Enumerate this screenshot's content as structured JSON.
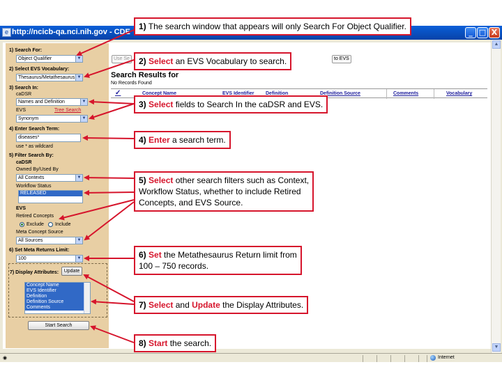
{
  "window": {
    "title": "http://ncicb-qa.nci.nih.gov - CDE",
    "buttons": {
      "minimize": "_",
      "maximize": "□",
      "close": "X"
    }
  },
  "left_panel": {
    "search_for": {
      "label": "1) Search For:",
      "value": "Object Qualifier"
    },
    "evs_vocab": {
      "label": "2) Select EVS Vocabulary:",
      "value": "Thesaurus/Metathesaurus"
    },
    "search_in": {
      "label": "3) Search In:",
      "cadsr_label": "caDSR",
      "cadsr_value": "Names and Definition",
      "evs_label": "EVS",
      "tree_search": "Tree Search",
      "evs_value": "Synonym"
    },
    "search_term": {
      "label": "4) Enter Search Term:",
      "value": "diseases*",
      "hint": "use * as wildcard"
    },
    "filter": {
      "label": "5) Filter Search By:",
      "cadsr_label": "caDSR",
      "owned_label": "Owned By/Used By",
      "owned_value": "All Contexts",
      "workflow_label": "Workflow Status",
      "workflow_selected": "RELEASED",
      "evs_label": "EVS",
      "retired_label": "Retired Concepts",
      "exclude_label": "Exclude",
      "include_label": "Include",
      "meta_source_label": "Meta Concept Source",
      "meta_source_value": "All Sources"
    },
    "meta_limit": {
      "label": "6) Set Meta Returns Limit:",
      "value": "100"
    },
    "display_attrs": {
      "label": "7) Display Attributes:",
      "update_button": "Update",
      "options": [
        "Concept Name",
        "EVS Identifier",
        "Definition",
        "Definition Source",
        "Comments"
      ]
    },
    "start_button": "Start Search"
  },
  "content": {
    "use_selection_button": "Use Se",
    "link_evs_button": "to EVS",
    "results_title": "Search Results for",
    "no_records": "No Records Found",
    "columns": [
      "Concept Name",
      "EVS Identifier",
      "Definition",
      "Definition Source",
      "Comments",
      "Vocabulary"
    ]
  },
  "status_bar": {
    "zone": "Internet"
  },
  "callouts": [
    {
      "num": "1)",
      "kw": "",
      "text": "The search window that appears will only Search For Object Qualifier."
    },
    {
      "num": "2)",
      "kw": "Select",
      "text": "an EVS Vocabulary to search."
    },
    {
      "num": "3)",
      "kw": "Select",
      "text": "fields to Search In the caDSR and EVS."
    },
    {
      "num": "4)",
      "kw": "Enter",
      "text": "a search term."
    },
    {
      "num": "5)",
      "kw": "Select",
      "line1": "other search filters such as Context,",
      "line2": "Workflow Status, whether to include Retired",
      "line3": "Concepts, and EVS Source."
    },
    {
      "num": "6)",
      "kw": "Set",
      "line1": "the Metathesaurus Return limit from",
      "line2": "100 – 750 records."
    },
    {
      "num": "7)",
      "kw": "Select",
      "mid": "and",
      "kw2": "Update",
      "text": "the Display Attributes."
    },
    {
      "num": "8)",
      "kw": "Start",
      "text": "the search."
    }
  ],
  "colors": {
    "callout_border": "#d6152c",
    "left_panel": "#e8cfa4",
    "titlebar": "#0842a8"
  }
}
